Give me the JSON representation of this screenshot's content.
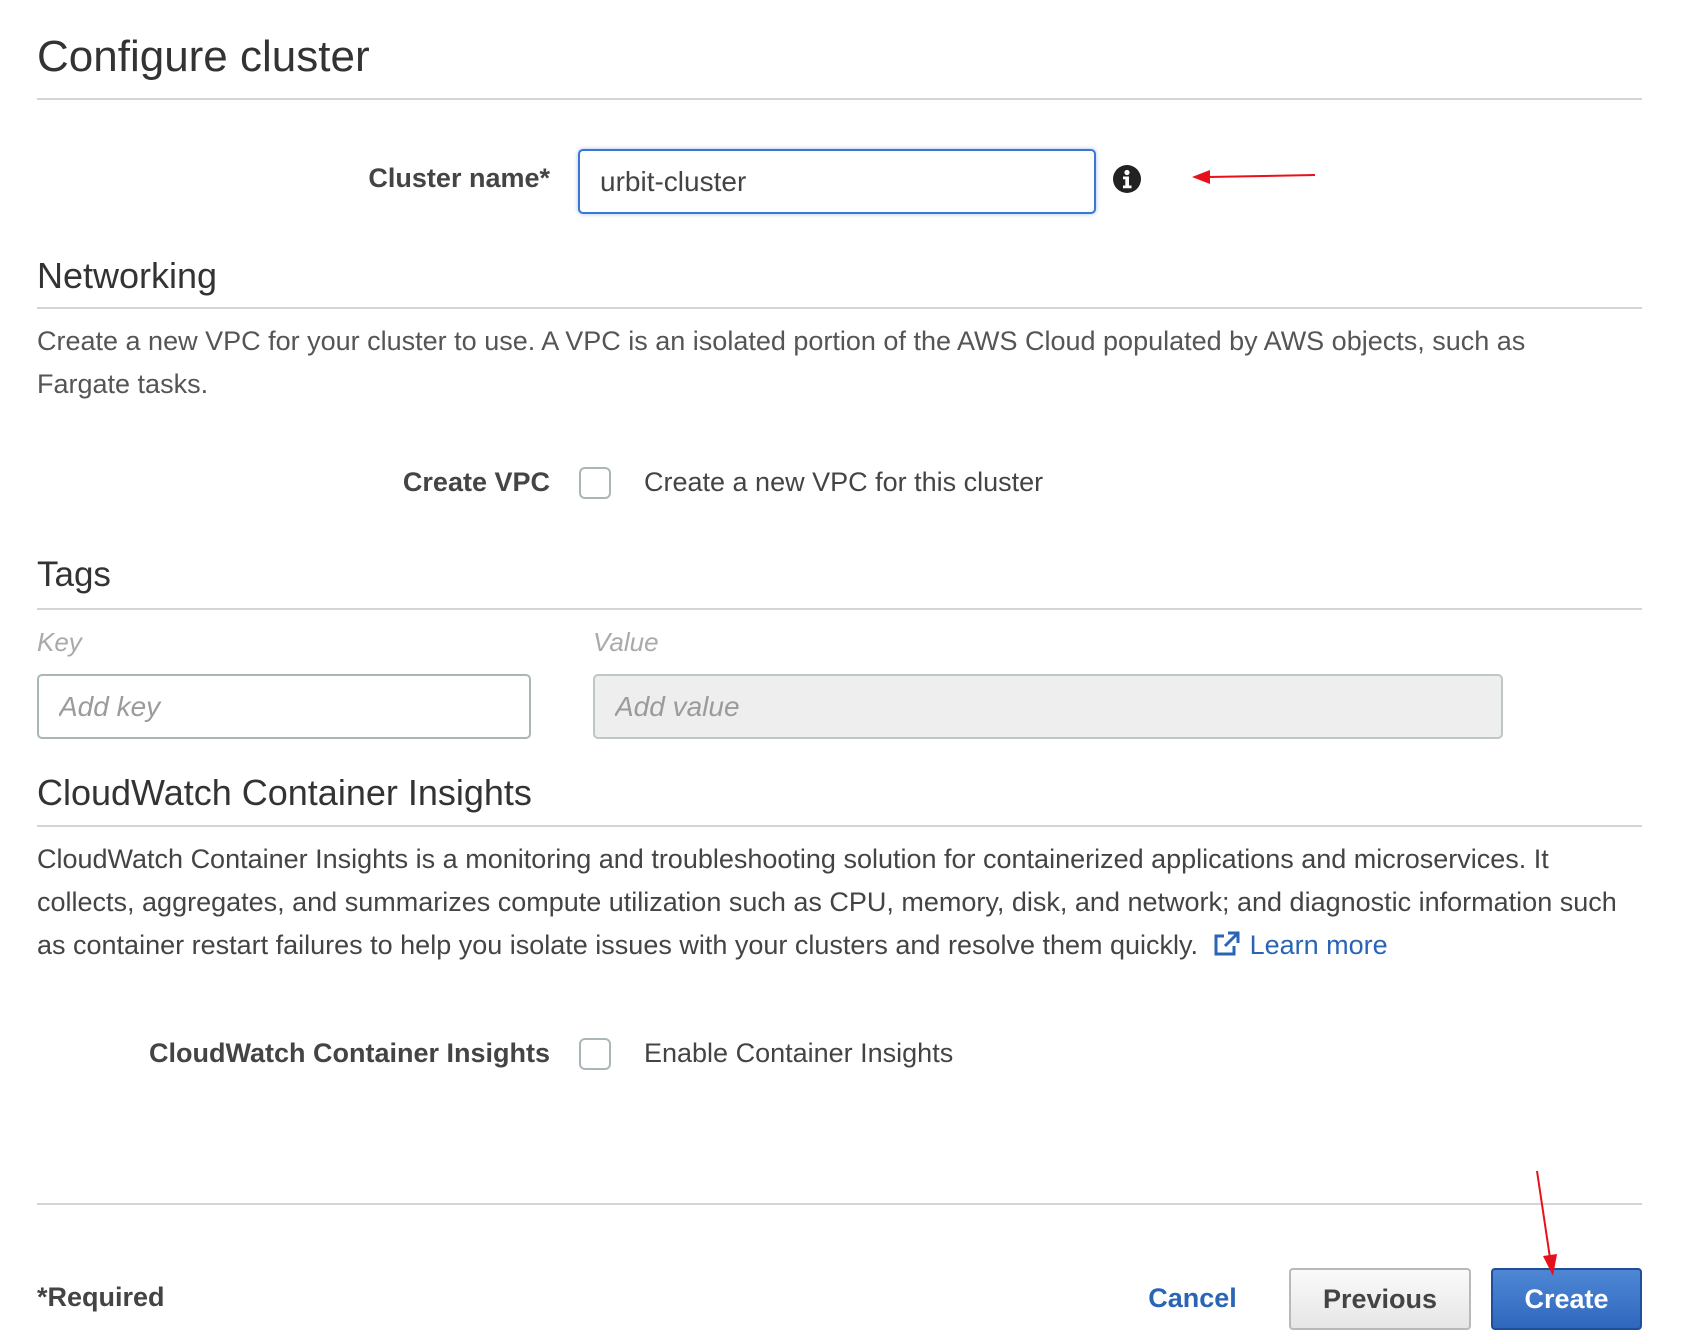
{
  "header": {
    "title": "Configure cluster"
  },
  "cluster": {
    "label": "Cluster name*",
    "value": "urbit-cluster",
    "info_icon": "info-icon"
  },
  "networking": {
    "title": "Networking",
    "description": "Create a new VPC for your cluster to use. A VPC is an isolated portion of the AWS Cloud populated by AWS objects, such as Fargate tasks.",
    "create_vpc_label": "Create VPC",
    "create_vpc_option": "Create a new VPC for this cluster",
    "create_vpc_checked": false
  },
  "tags": {
    "title": "Tags",
    "key_header": "Key",
    "value_header": "Value",
    "key_placeholder": "Add key",
    "value_placeholder": "Add value"
  },
  "insights": {
    "title": "CloudWatch Container Insights",
    "description": "CloudWatch Container Insights is a monitoring and troubleshooting solution for containerized applications and microservices. It collects, aggregates, and summarizes compute utilization such as CPU, memory, disk, and network; and diagnostic information such as container restart failures to help you isolate issues with your clusters and resolve them quickly.",
    "learn_more": "Learn more",
    "field_label": "CloudWatch Container Insights",
    "option_label": "Enable Container Insights",
    "enabled": false
  },
  "footer": {
    "required_note": "*Required",
    "cancel_label": "Cancel",
    "previous_label": "Previous",
    "create_label": "Create"
  },
  "colors": {
    "primary": "#2f67bd",
    "link": "#2a64b5",
    "annotation_arrow": "#e8101a"
  }
}
